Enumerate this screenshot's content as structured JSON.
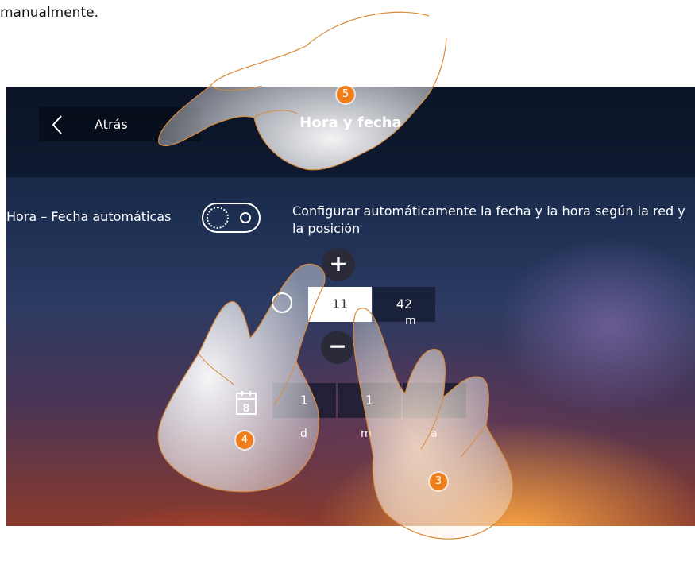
{
  "intro_text": "manualmente.",
  "header": {
    "back_label": "Atrás",
    "title": "Hora y fecha"
  },
  "auto_setting": {
    "label": "Hora – Fecha automáticas",
    "description": "Configurar automáticamente la fecha y la hora según la red y la posición",
    "enabled": false
  },
  "time": {
    "increase_symbol": "+",
    "decrease_symbol": "−",
    "hours": "11",
    "minutes": "42",
    "minutes_label": "m"
  },
  "date": {
    "calendar_day": "8",
    "day_value_partial": "1",
    "month_value_partial": "1",
    "day_label": "d",
    "month_label": "m",
    "year_label": "a"
  },
  "step_badges": [
    "5",
    "4",
    "3"
  ],
  "colors": {
    "badge": "#ee7d1a",
    "selected_field": "#ffffff",
    "dark_field": "#1c2238"
  }
}
